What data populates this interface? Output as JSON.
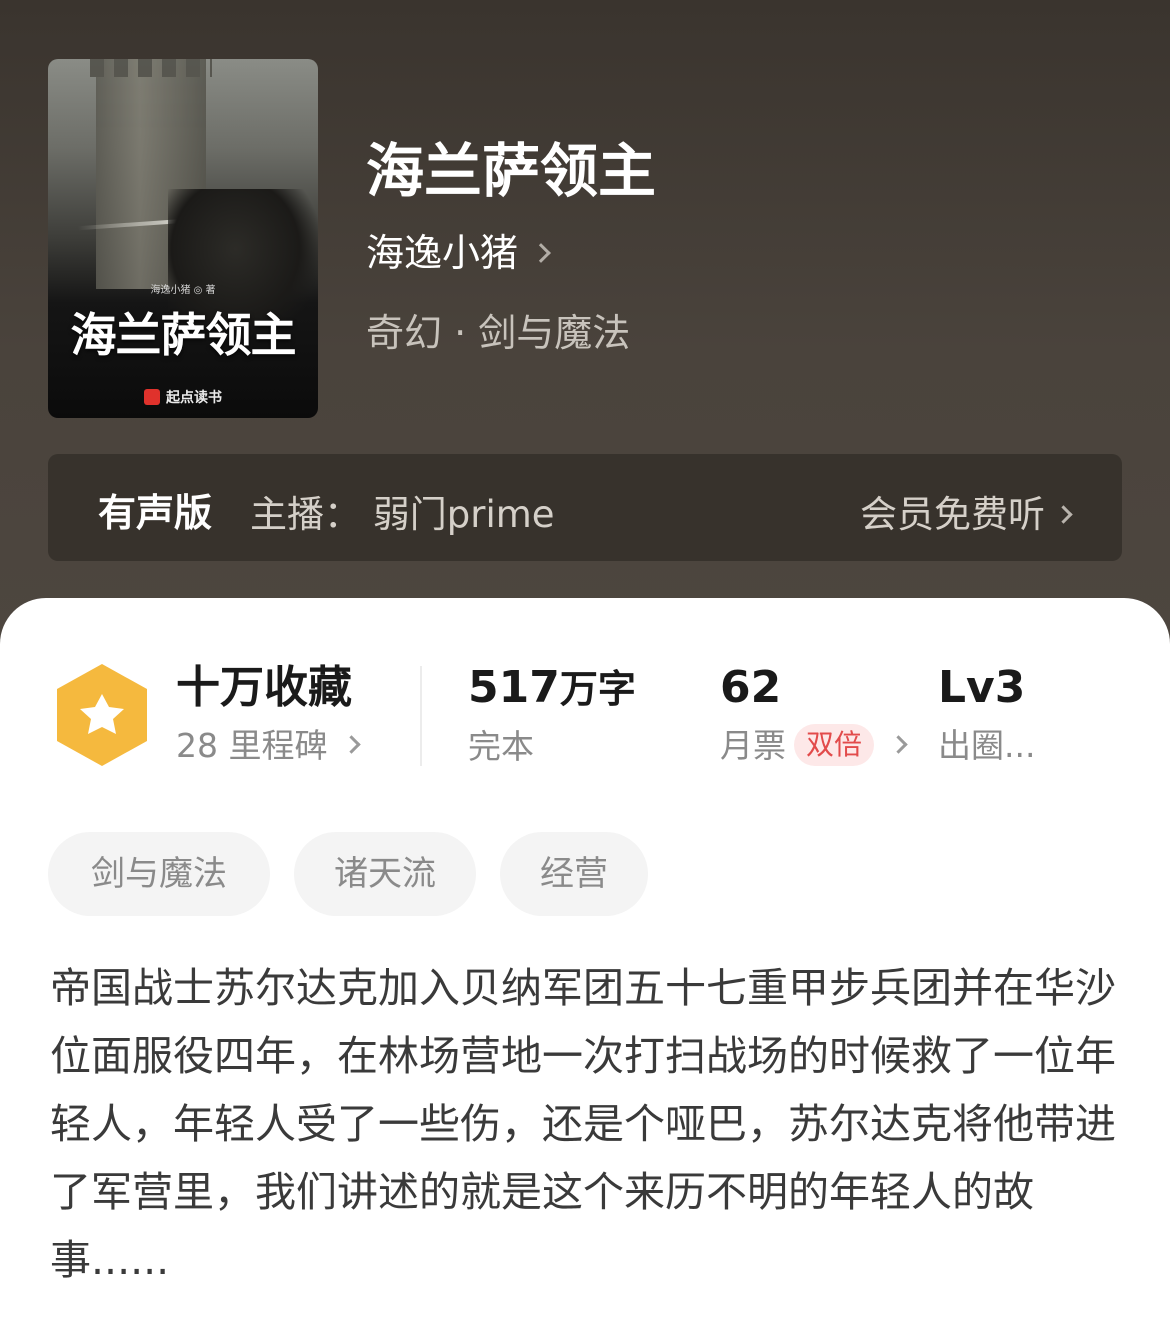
{
  "book": {
    "title": "海兰萨领主",
    "author": "海逸小猪",
    "genre": "奇幻 · 剑与魔法",
    "cover": {
      "author_line": "海逸小猪 ◎ 著",
      "title": "海兰萨领主",
      "publisher": "起点读书"
    }
  },
  "audio": {
    "label": "有声版",
    "host": "主播：  弱门prime",
    "cta": "会员免费听"
  },
  "stats": {
    "favorites": {
      "main": "十万收藏",
      "sub": "28 里程碑"
    },
    "words": {
      "number": "517",
      "unit": "万字",
      "sub": "完本"
    },
    "monthly": {
      "main": "62",
      "sub": "月票",
      "tag": "双倍"
    },
    "level": {
      "main": "Lv3",
      "sub": "出圈..."
    }
  },
  "tags": [
    "剑与魔法",
    "诸天流",
    "经营"
  ],
  "description": "帝国战士苏尔达克加入贝纳军团五十七重甲步兵团并在华沙位面服役四年，在林场营地一次打扫战场的时候救了一位年轻人，年轻人受了一些伤，还是个哑巴，苏尔达克将他带进了军营里，我们讲述的就是这个来历不明的年轻人的故事......",
  "colors": {
    "badge": "#f5b93e",
    "double_tag_bg": "#fde8e8",
    "double_tag_text": "#e24b4b"
  },
  "icons": {
    "badge": "star-hexagon-icon",
    "arrow": "chevron-right-icon"
  }
}
